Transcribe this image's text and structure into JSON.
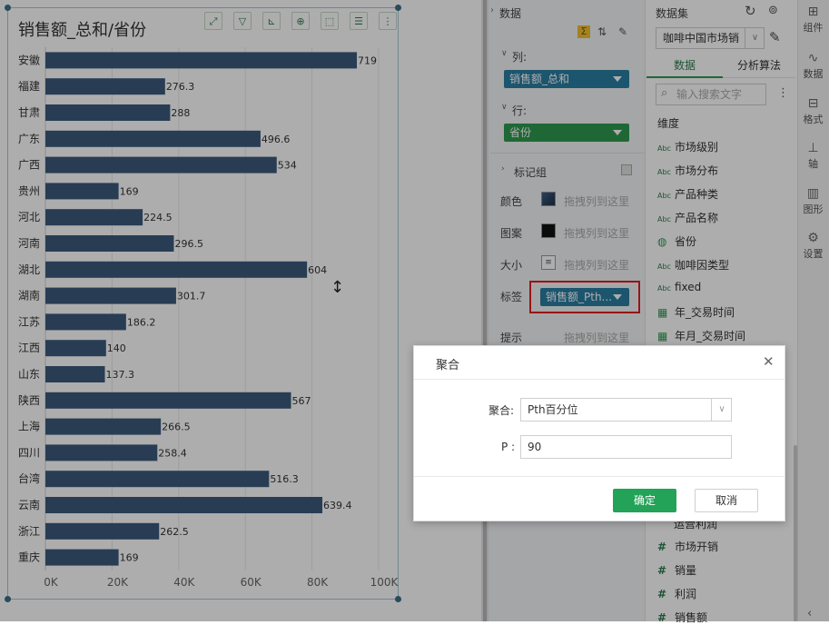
{
  "chart": {
    "title": "销售额_总和/省份",
    "toolbar": [
      "fullscreen-icon",
      "filter-icon",
      "axis-swap-icon",
      "zoom-icon",
      "select-icon",
      "list-icon",
      "more-icon"
    ]
  },
  "chart_data": {
    "type": "bar",
    "orientation": "horizontal",
    "title": "销售额_总和/省份",
    "categories": [
      "安徽",
      "福建",
      "甘肃",
      "广东",
      "广西",
      "贵州",
      "河北",
      "河南",
      "湖北",
      "湖南",
      "江苏",
      "江西",
      "山东",
      "陕西",
      "上海",
      "四川",
      "台湾",
      "云南",
      "浙江",
      "重庆"
    ],
    "values": [
      719,
      276.3,
      288,
      496.6,
      534,
      169,
      224.5,
      296.5,
      604,
      301.7,
      186.2,
      140,
      137.3,
      567,
      266.5,
      258.4,
      516.3,
      639.4,
      262.5,
      169
    ],
    "value_labels": [
      "719",
      "276.3",
      "288",
      "496.6",
      "534",
      "169",
      "224.5",
      "296.5",
      "604",
      "301.7",
      "186.2",
      "140",
      "137.3",
      "567",
      "266.5",
      "258.4",
      "516.3",
      "639.4",
      "262.5",
      "169"
    ],
    "bar_value_scale": 130,
    "x_ticks": [
      "0K",
      "20K",
      "40K",
      "60K",
      "80K",
      "100K"
    ],
    "x_tick_values": [
      0,
      20000,
      40000,
      60000,
      80000,
      100000
    ],
    "xlim": [
      0,
      103000
    ],
    "grid": true,
    "bar_color": "#3c5a7c"
  },
  "mid": {
    "header": "数据",
    "col_label": "列:",
    "col_field": "销售额_总和",
    "row_label": "行:",
    "row_field": "省份",
    "mark_group": "标记组",
    "color_label": "颜色",
    "pattern_label": "图案",
    "size_label": "大小",
    "tag_label": "标签",
    "tag_field": "销售额_Pth...",
    "tip_label": "提示",
    "drop_hint": "拖拽列到这里",
    "colors": {
      "col_pill": "#2a7ea3",
      "row_pill": "#2e9a4f",
      "tag_pill": "#2a7ea3",
      "highlight": "#e02020"
    }
  },
  "right": {
    "dataset_label": "数据集",
    "dataset_value": "咖啡中国市场销",
    "tab_data": "数据",
    "tab_analysis": "分析算法",
    "search_placeholder": "输入搜索文字",
    "dim_header": "维度",
    "dims": [
      {
        "icon": "Abc",
        "label": "市场级别"
      },
      {
        "icon": "Abc",
        "label": "市场分布"
      },
      {
        "icon": "Abc",
        "label": "产品种类"
      },
      {
        "icon": "Abc",
        "label": "产品名称"
      },
      {
        "icon": "globe",
        "label": "省份"
      },
      {
        "icon": "Abc",
        "label": "咖啡因类型"
      },
      {
        "icon": "Abc",
        "label": "fixed"
      },
      {
        "icon": "cal",
        "label": "年_交易时间"
      },
      {
        "icon": "cal",
        "label": "年月_交易时间"
      }
    ],
    "measures": [
      {
        "icon": "#",
        "label": "市场开销"
      },
      {
        "icon": "#",
        "label": "销量"
      },
      {
        "icon": "#",
        "label": "利润"
      },
      {
        "icon": "#",
        "label": "销售额"
      }
    ],
    "partial_row": "运营利润"
  },
  "rail": [
    {
      "icon": "component-icon",
      "label": "组件"
    },
    {
      "icon": "data-icon",
      "label": "数据"
    },
    {
      "icon": "format-icon",
      "label": "格式"
    },
    {
      "icon": "axis-icon",
      "label": "轴"
    },
    {
      "icon": "shape-icon",
      "label": "图形"
    },
    {
      "icon": "settings-icon",
      "label": "设置"
    }
  ],
  "dialog": {
    "title": "聚合",
    "agg_label": "聚合:",
    "agg_value": "Pth百分位",
    "p_label": "P :",
    "p_value": "90",
    "ok": "确定",
    "cancel": "取消",
    "ok_color": "#22a358"
  }
}
